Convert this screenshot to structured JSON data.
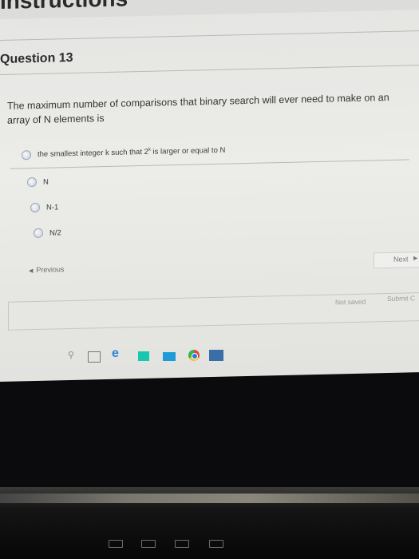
{
  "page": {
    "heading": "Instructions"
  },
  "question": {
    "title": "Question 13",
    "text": "The maximum number of comparisons that binary search will ever need to make on an array of N elements is",
    "options": [
      {
        "label_main": "the smallest integer k such that 2",
        "label_sup": "k",
        "label_tail": " is larger or equal to N"
      },
      {
        "label": "N"
      },
      {
        "label": "N-1"
      },
      {
        "label": "N/2"
      }
    ]
  },
  "nav": {
    "previous": "Previous",
    "next": "Next"
  },
  "status": {
    "not_saved": "Not saved",
    "submit": "Submit C"
  },
  "taskbar": {
    "icons": [
      "search-icon",
      "task-view-icon",
      "edge-icon",
      "store-icon",
      "photos-icon",
      "chrome-icon",
      "app-icon"
    ]
  },
  "colors": {
    "edge": "#2b85d6",
    "store": "#17c7b1",
    "photos": "#1f9ad8"
  }
}
